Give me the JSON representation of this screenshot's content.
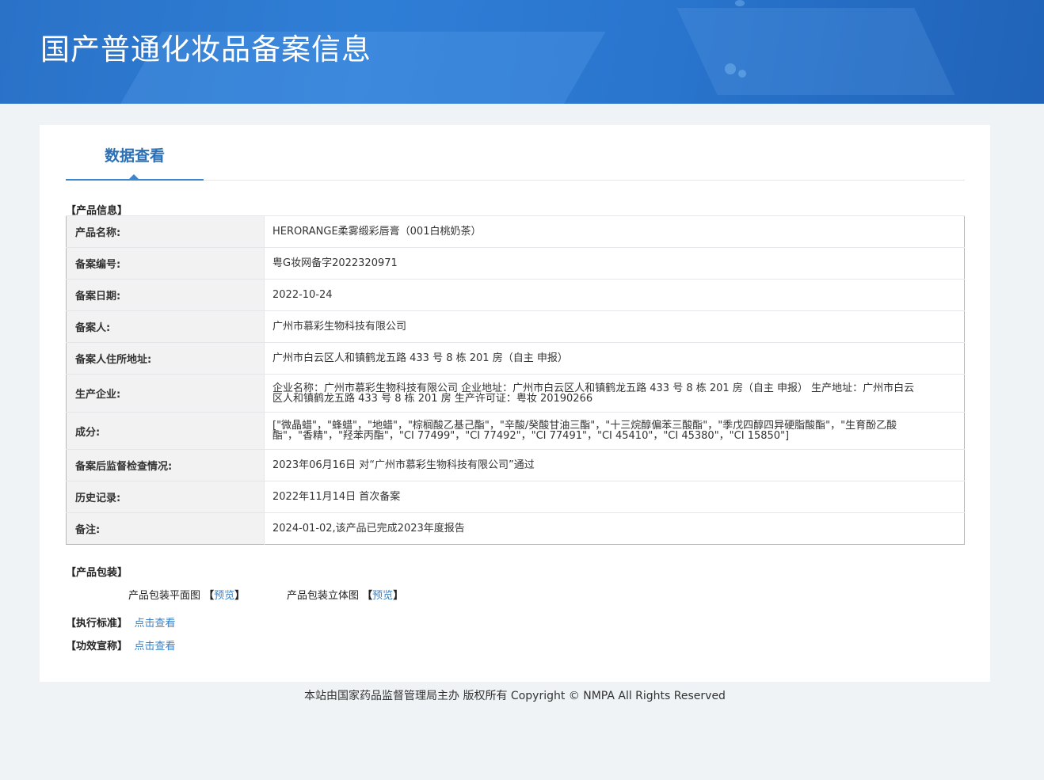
{
  "header": {
    "title": "国产普通化妆品备案信息"
  },
  "tabs": [
    {
      "label": "数据查看"
    }
  ],
  "product_info": {
    "section_label": "【产品信息】",
    "rows": [
      {
        "key": "产品名称:",
        "value": "HERORANGE柔雾缎彩唇膏（001白桃奶茶）"
      },
      {
        "key": "备案编号:",
        "value": "粤G妆网备字2022320971"
      },
      {
        "key": "备案日期:",
        "value": "2022-10-24"
      },
      {
        "key": "备案人:",
        "value": "广州市慕彩生物科技有限公司"
      },
      {
        "key": "备案人住所地址:",
        "value": "广州市白云区人和镇鹤龙五路 433 号 8 栋 201 房（自主 申报）"
      },
      {
        "key": "生产企业:",
        "value": "企业名称：广州市慕彩生物科技有限公司 企业地址：广州市白云区人和镇鹤龙五路 433 号 8 栋 201 房（自主 申报） 生产地址：广州市白云区人和镇鹤龙五路 433 号 8 栋 201 房 生产许可证：粤妆 20190266"
      },
      {
        "key": "成分:",
        "value": "[\"微晶蜡\"，\"蜂蜡\"，\"地蜡\"，\"棕榈酸乙基己酯\"，\"辛酸/癸酸甘油三酯\"，\"十三烷醇偏苯三酸酯\"，\"季戊四醇四异硬脂酸酯\"，\"生育酚乙酸酯\"，\"香精\"，\"羟苯丙酯\"，\"CI 77499\"，\"CI 77492\"，\"CI 77491\"，\"CI 45410\"，\"CI 45380\"，\"CI 15850\"]"
      },
      {
        "key": "备案后监督检查情况:",
        "value": "2023年06月16日 对“广州市慕彩生物科技有限公司”通过"
      },
      {
        "key": "历史记录:",
        "value": "2022年11月14日 首次备案"
      },
      {
        "key": "备注:",
        "value": "2024-01-02,该产品已完成2023年度报告"
      }
    ]
  },
  "packaging": {
    "section_label": "【产品包装】",
    "flat_label": "产品包装平面图",
    "flat_link": "预览",
    "solid_label": "产品包装立体图",
    "solid_link": "预览",
    "bracket_open": "【",
    "bracket_close": "】"
  },
  "standard": {
    "section_label": "【执行标准】",
    "link": "点击查看"
  },
  "efficacy": {
    "section_label": "【功效宣称】",
    "link": "点击查看"
  },
  "footer": {
    "text": "本站由国家药品监督管理局主办 版权所有 Copyright © NMPA All Rights Reserved"
  }
}
